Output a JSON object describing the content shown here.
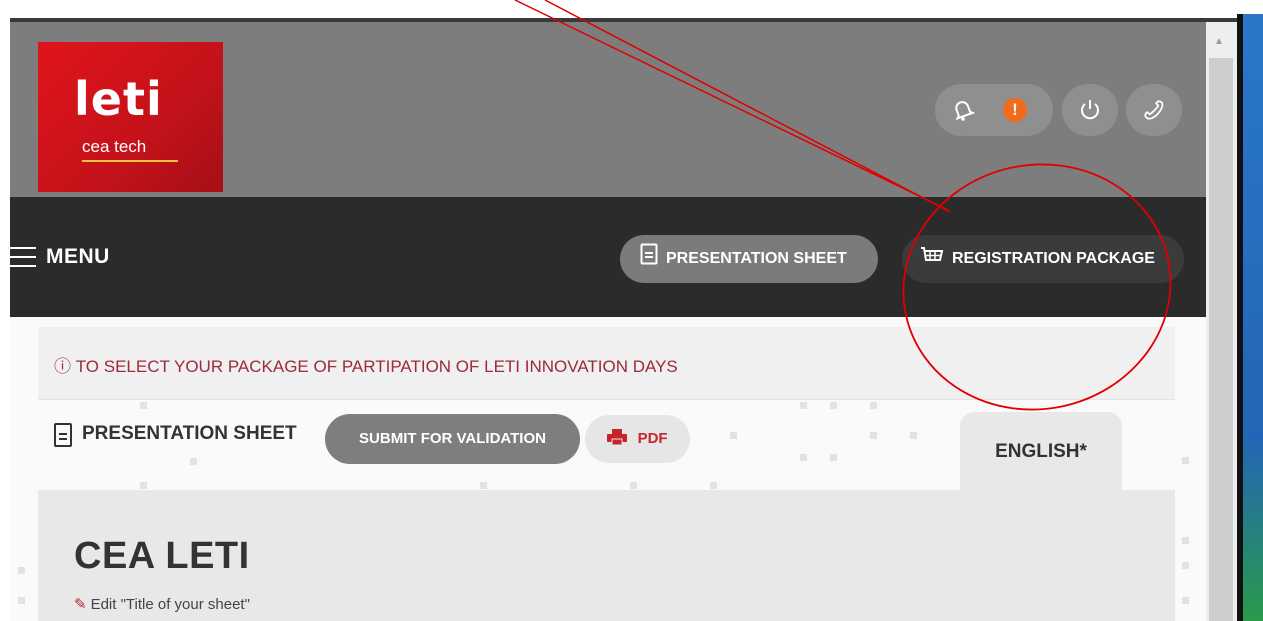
{
  "logo": {
    "main": "leti",
    "sub": "cea tech"
  },
  "header": {
    "icons": [
      "bell-icon",
      "alert-icon",
      "power-icon",
      "phone-icon"
    ],
    "alert_symbol": "!"
  },
  "navbar": {
    "menu_label": "MENU",
    "presentation_sheet_label": "PRESENTATION SHEET",
    "registration_package_label": "REGISTRATION PACKAGE"
  },
  "info": {
    "message": "TO SELECT YOUR PACKAGE OF PARTIPATION OF LETI INNOVATION DAYS"
  },
  "sheet": {
    "title": "PRESENTATION SHEET",
    "submit_label": "SUBMIT FOR VALIDATION",
    "pdf_label": "PDF",
    "language_tab": "ENGLISH*"
  },
  "content": {
    "org_title": "CEA LETI",
    "edit_label": "Edit \"Title of your sheet\""
  },
  "colors": {
    "header_gray": "#7d7d7d",
    "navbar": "#2b2b2b",
    "brand_red": "#d3121a",
    "alert_orange": "#f26a1b",
    "info_text": "#9a2a3c",
    "annotation_red": "#e00000"
  }
}
